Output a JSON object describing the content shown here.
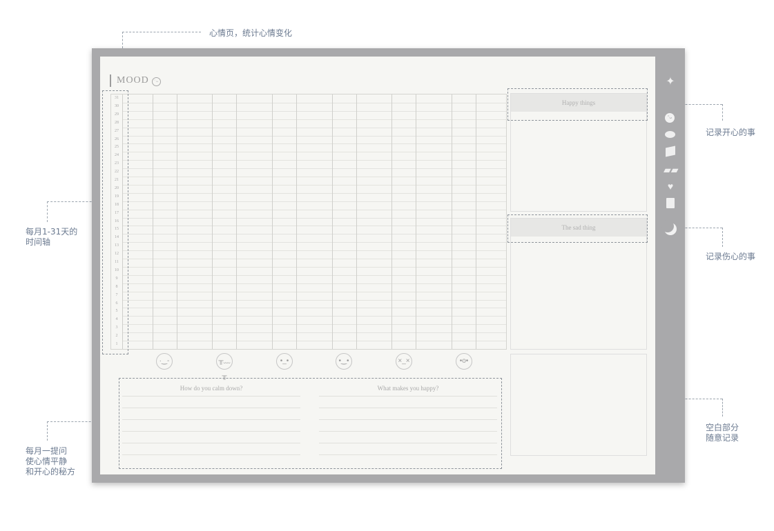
{
  "annotations": {
    "mood_page": "心情页，统计心情变化",
    "happy_record": "记录开心的事",
    "sad_record": "记录伤心的事",
    "timeline": "每月1-31天的\n时间轴",
    "calm_questions": "每月一提问\n使心情平静\n和开心的秘方",
    "blank_area": "空白部分\n随意记录"
  },
  "page": {
    "title": "MOOD",
    "title_icon": "smiley-face-icon"
  },
  "tracker": {
    "days": [
      "31",
      "30",
      "29",
      "28",
      "27",
      "26",
      "25",
      "24",
      "23",
      "22",
      "21",
      "20",
      "19",
      "18",
      "17",
      "16",
      "15",
      "14",
      "13",
      "12",
      "11",
      "10",
      "9",
      "8",
      "7",
      "6",
      "5",
      "4",
      "3",
      "2",
      "1"
    ],
    "mood_faces": [
      {
        "icon": "winking-face-icon",
        "glyph": "·‿-"
      },
      {
        "icon": "crying-face-icon",
        "glyph": "╥﹏╥"
      },
      {
        "icon": "neutral-face-icon",
        "glyph": "•_•"
      },
      {
        "icon": "calm-face-icon",
        "glyph": "•‿•"
      },
      {
        "icon": "sad-face-icon",
        "glyph": "×_×"
      },
      {
        "icon": "surprised-face-icon",
        "glyph": "•o•"
      }
    ]
  },
  "happy_panel": {
    "title": "Happy things"
  },
  "sad_panel": {
    "title": "The sad thing"
  },
  "questions": [
    {
      "title": "How do you calm down?"
    },
    {
      "title": "What makes you happy?"
    }
  ],
  "sidebar_icons": [
    "sparkle-icon",
    "smiley-icon",
    "chat-bubble-icon",
    "clapperboard-icon",
    "book-icon",
    "heart-icon",
    "note-icon",
    "moon-icon"
  ]
}
